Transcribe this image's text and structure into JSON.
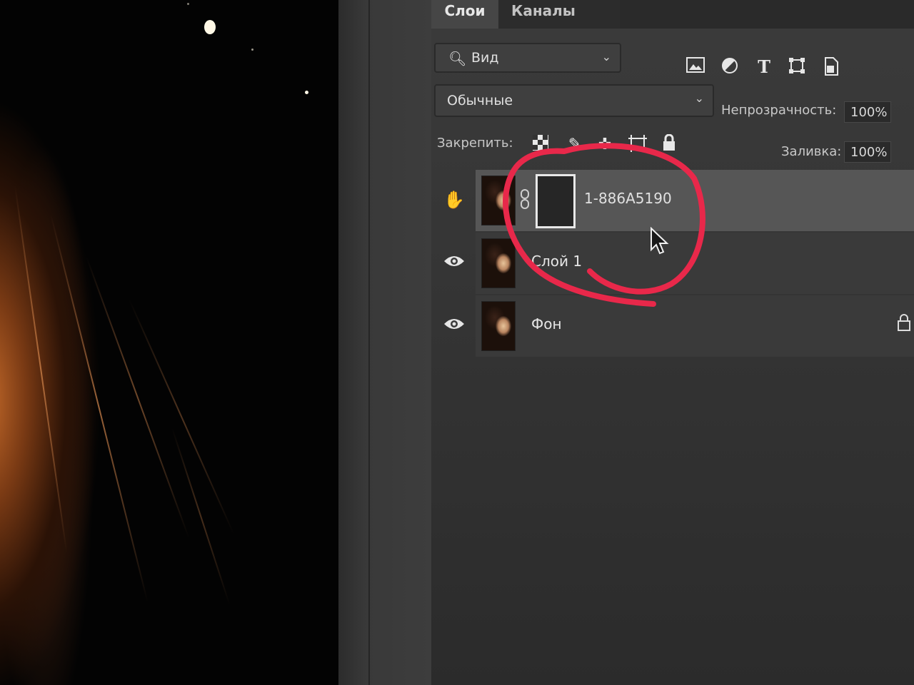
{
  "tabs": {
    "layers": "Слои",
    "channels": "Каналы"
  },
  "filter": {
    "icon": "search-icon",
    "label": "Вид",
    "chevron": "⌄"
  },
  "filter_icons": [
    "image-icon",
    "adjustment-icon",
    "type-icon",
    "shape-icon",
    "smart-object-icon"
  ],
  "blend": {
    "mode": "Обычные",
    "chevron": "⌄"
  },
  "opacity": {
    "label": "Непрозрачность:",
    "value": "100%"
  },
  "lock": {
    "label": "Закрепить:",
    "icons": [
      "lock-transparent-icon",
      "lock-pixels-icon",
      "lock-position-icon",
      "lock-artboard-icon",
      "lock-all-icon"
    ]
  },
  "fill": {
    "label": "Заливка:",
    "value": "100%"
  },
  "layers": [
    {
      "name": "1-886A5190",
      "visibility_icon": "hand-cursor-icon",
      "has_mask": true,
      "selected": true
    },
    {
      "name": "Слой 1",
      "visibility_icon": "eye-icon",
      "has_mask": false,
      "selected": false
    },
    {
      "name": "Фон",
      "visibility_icon": "eye-icon",
      "has_mask": false,
      "locked": true,
      "selected": false
    }
  ],
  "colors": {
    "panel_bg": "#353535",
    "selected_row": "#565656",
    "annotation": "#e8284a"
  }
}
